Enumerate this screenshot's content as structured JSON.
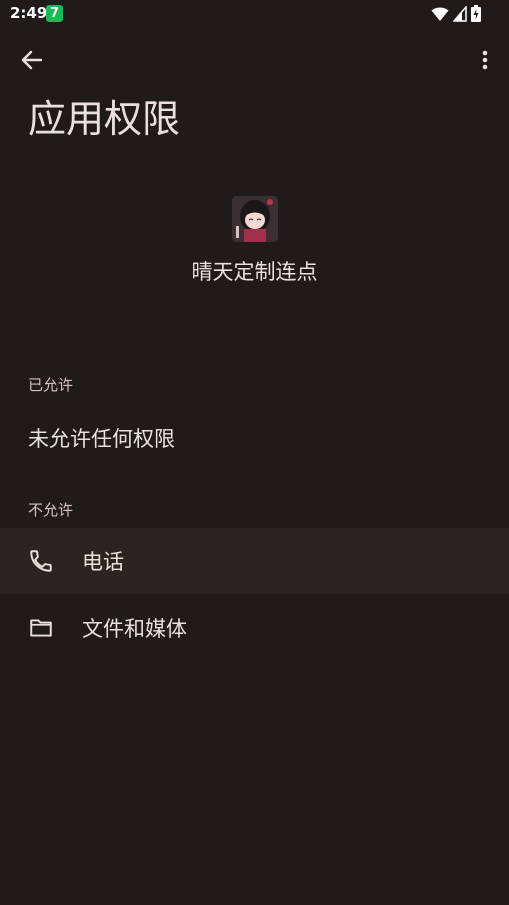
{
  "status_bar": {
    "time": "2:49",
    "notification_badge": "7"
  },
  "toolbar": {
    "back_icon": "arrow-left-icon",
    "more_icon": "more-vert-icon"
  },
  "page": {
    "title": "应用权限"
  },
  "app": {
    "name": "晴天定制连点"
  },
  "sections": {
    "allowed_header": "已允许",
    "allowed_empty": "未允许任何权限",
    "denied_header": "不允许",
    "denied_items": [
      {
        "label": "电话",
        "icon": "phone-icon"
      },
      {
        "label": "文件和媒体",
        "icon": "folder-icon"
      }
    ]
  },
  "colors": {
    "background": "#201a1a",
    "highlight_row": "#2a2422",
    "text_primary": "#ece0df",
    "text_secondary": "#d8c3c2"
  }
}
